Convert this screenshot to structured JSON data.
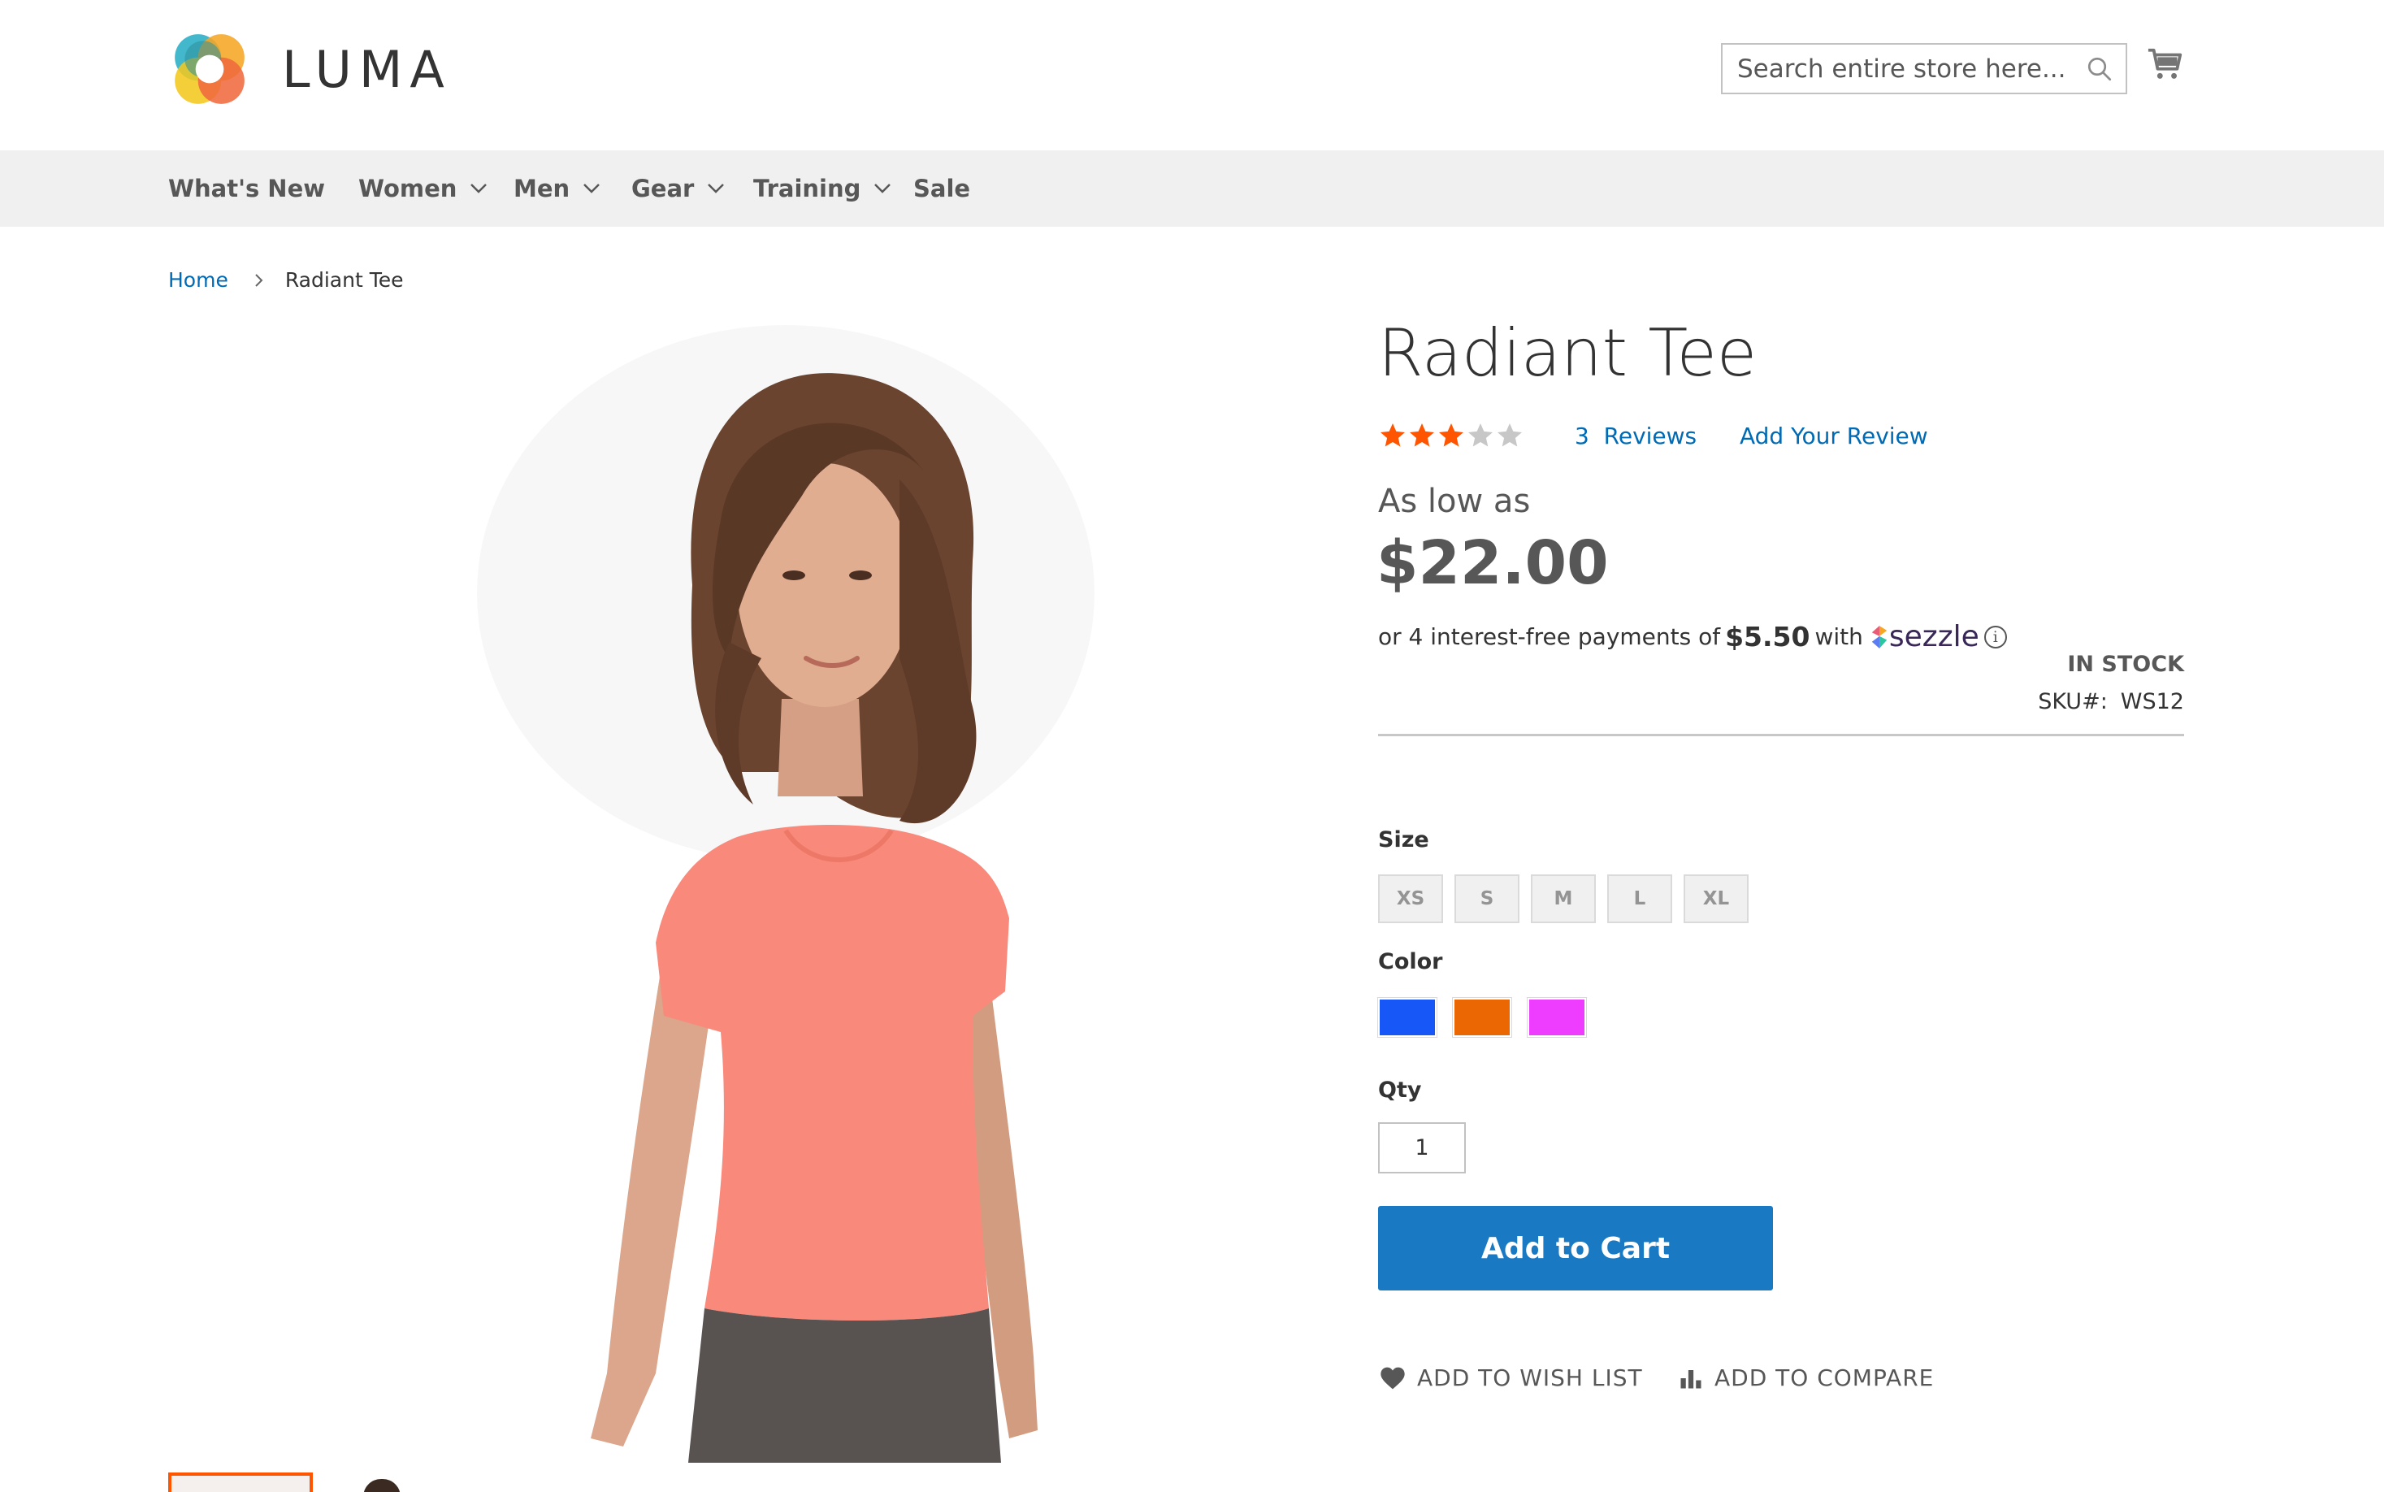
{
  "header": {
    "logo_text": "LUMA",
    "search_placeholder": "Search entire store here...",
    "icons": {
      "search": "search-icon",
      "cart": "cart-icon"
    }
  },
  "nav": {
    "items": [
      {
        "label": "What's New",
        "has_dropdown": false
      },
      {
        "label": "Women",
        "has_dropdown": true
      },
      {
        "label": "Men",
        "has_dropdown": true
      },
      {
        "label": "Gear",
        "has_dropdown": true
      },
      {
        "label": "Training",
        "has_dropdown": true
      },
      {
        "label": "Sale",
        "has_dropdown": false
      }
    ]
  },
  "breadcrumb": {
    "home": "Home",
    "current": "Radiant Tee"
  },
  "product": {
    "title": "Radiant Tee",
    "rating": {
      "stars": 3,
      "out_of": 5
    },
    "reviews_count": "3",
    "reviews_label": "Reviews",
    "add_review_label": "Add Your Review",
    "as_low_as": "As low as",
    "price": "$22.00",
    "sezzle": {
      "prefix": "or 4 interest-free payments of",
      "amount": "$5.50",
      "with": "with",
      "brand": "sezzle",
      "info_icon": "info-icon"
    },
    "stock": "IN STOCK",
    "sku_label": "SKU#:",
    "sku": "WS12",
    "size_label": "Size",
    "sizes": [
      "XS",
      "S",
      "M",
      "L",
      "XL"
    ],
    "color_label": "Color",
    "colors": [
      "#1857f7",
      "#eb6703",
      "#ef3dff"
    ],
    "qty_label": "Qty",
    "qty": "1",
    "add_to_cart": "Add to Cart",
    "wish_list": "ADD TO WISH LIST",
    "compare": "ADD TO COMPARE"
  },
  "colors": {
    "link": "#006bb4",
    "primary_button": "#1979c3",
    "star": "#ff5501",
    "active_thumb": "#ff5501"
  }
}
